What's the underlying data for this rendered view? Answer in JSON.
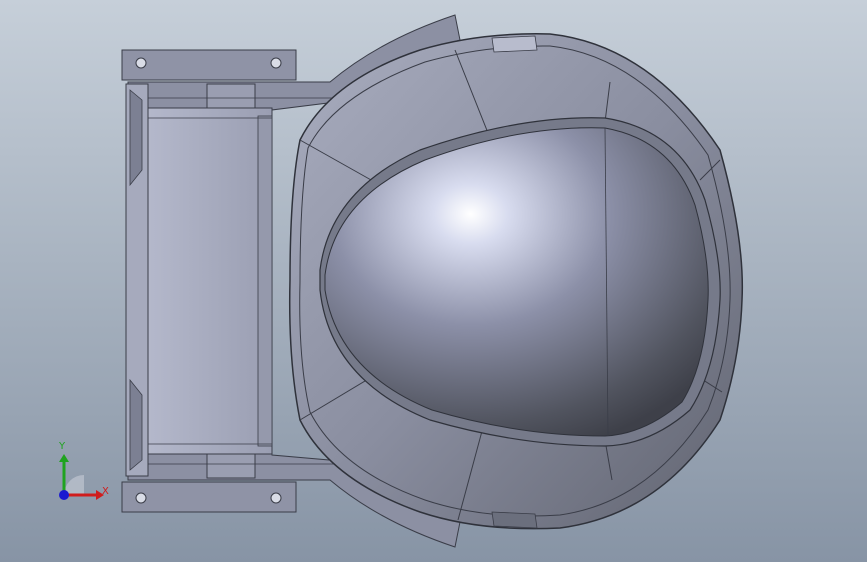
{
  "viewport": {
    "background_top": "#c3ccd6",
    "background_bottom": "#8592a3",
    "model_color": "#7e8294",
    "edge_color": "#3a3d48"
  },
  "triad": {
    "x_label": "X",
    "y_label": "Y",
    "x_color": "#d01c1c",
    "y_color": "#1fa31f",
    "z_color": "#1a1ad0"
  }
}
